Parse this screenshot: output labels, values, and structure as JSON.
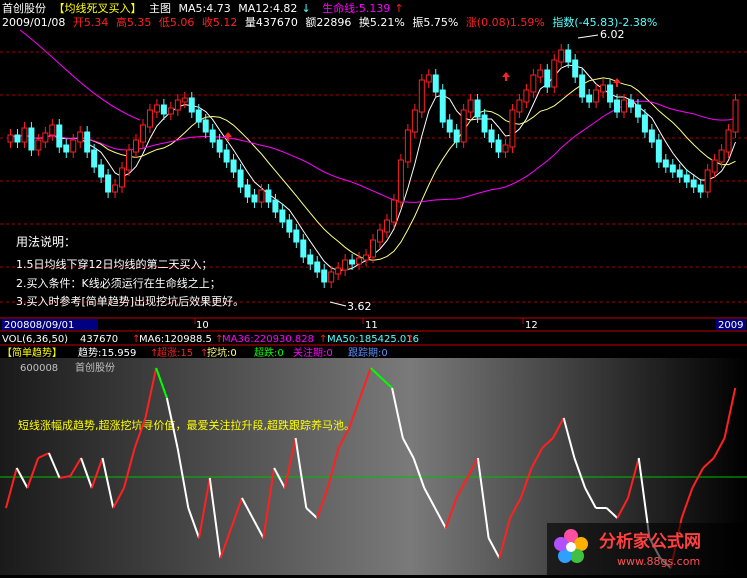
{
  "top_panel": {
    "stock_name": "首创股份",
    "indicator_name": "【均线死叉买入】",
    "main_chart": "主图",
    "ma5": "MA5:4.73",
    "ma12": "MA12:4.82",
    "ma12_arrow": "↓",
    "life_line": "生命线:5.139",
    "life_arrow": "↑",
    "date": "2009/01/08",
    "open": "开5.34",
    "high": "高5.35",
    "low": "低5.06",
    "close": "收5.12",
    "volume": "量437670",
    "amount": "额22896",
    "turnover": "换5.21%",
    "amplitude": "振5.75%",
    "change": "涨(0.08)1.59%",
    "index": "指数(-45.83)-2.38%",
    "high_mark": "6.02",
    "low_mark": "3.62",
    "usage_title": "用法说明：",
    "usage_1": "1.5日均线下穿12日均线的第二天买入；",
    "usage_2": "2.买入条件：K线必须运行在生命线之上；",
    "usage_3": "3.买入时参考[简单趋势]出现挖坑后效果更好。",
    "x_labels": [
      "200808/09/01",
      "10",
      "11",
      "12",
      "2009"
    ],
    "colors": {
      "up": "#ff2020",
      "down": "#54ffff",
      "ma5": "#ffffff",
      "ma12": "#ffff80",
      "life": "#ff00ff",
      "grid": "#a00000"
    }
  },
  "volume_panel": {
    "vol_label": "VOL(6,36,50)",
    "vol_value": "437670",
    "ma6": "MA6:120988.5",
    "ma36": "MA36:220930.828",
    "ma50": "MA50:185425.016"
  },
  "trend_panel": {
    "title": "【简单趋势】",
    "trend": "趋势:15.959",
    "super_up": "超涨:15",
    "dig": "挖坑:0",
    "super_down": "超跌:0",
    "watch": "关注期:0",
    "track": "跟踪期:0",
    "code": "600008",
    "name": "首创股份",
    "note": "短线涨幅成趋势,超涨挖坑寻价值，最爱关注拉升段,超跌跟踪养马池。"
  },
  "watermark": {
    "text": "分析家公式网",
    "url": "www.88gs.com"
  }
}
